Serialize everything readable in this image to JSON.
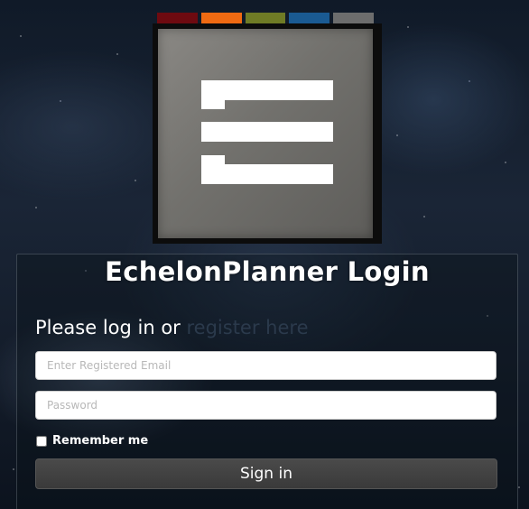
{
  "logo": {
    "strip_colors": [
      "#6e0a10",
      "#f06a12",
      "#6f7b25",
      "#1a5a92",
      "#6d6d6d"
    ],
    "box_color": "#7a7874",
    "mark_color": "#ffffff"
  },
  "login": {
    "title": "EchelonPlanner Login",
    "prompt_text": "Please log in or ",
    "register_link": "register here",
    "email_placeholder": "Enter Registered Email",
    "password_placeholder": "Password",
    "remember_label": "Remember me",
    "signin_label": "Sign in"
  }
}
